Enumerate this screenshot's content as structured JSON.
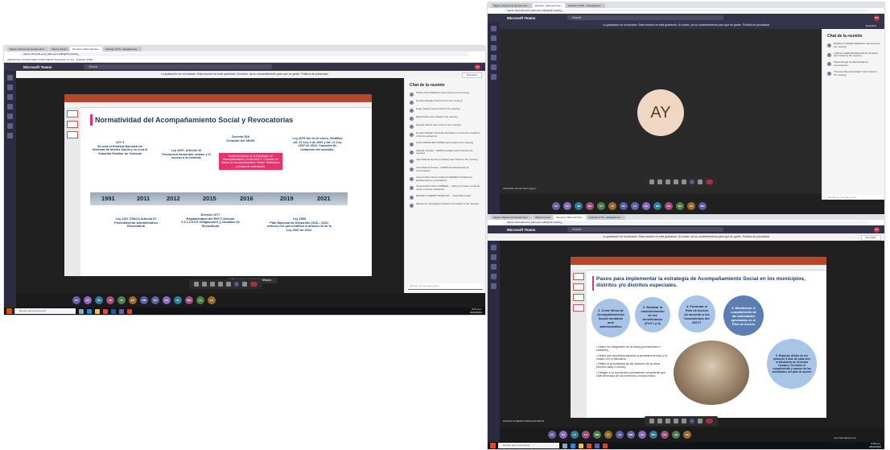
{
  "screenshot1": {
    "tabs": [
      "Sigob | Sistema de Gestión Doc...",
      "Yahoo! Correo",
      "Reunión | Microsoft Tea...",
      "Noticias (773) - delegaciones..."
    ],
    "url": "teams.microsoft.com/_#/pre-join-calling/19:meeting_",
    "bookmarks": "Aplicaciones   YouTube   Maps   Gmail   Traducir   Asociación en Col...   Noticias (1790) ...",
    "app_title": "Microsoft Teams",
    "search_placeholder": "Buscar",
    "recording_notice": "La grabación se ha iniciado. Esta reunión se está grabando. Al unirse, da su consentimiento para que se grabe. Política de privacidad",
    "dismiss_label": "Descartar",
    "slide": {
      "title": "Normatividad del Acompañamiento Social y Revocatorias",
      "years": [
        "1991",
        "2011",
        "2012",
        "2015",
        "2016",
        "2019",
        "2021"
      ],
      "notes_top": [
        "LEY 3\nSe crea el Sistema Nacional de Vivienda de Interés Social y se crea el Subsidio Familiar de Vivienda",
        "Ley 1537, Artículo 16\nPromoción desarrollo urbano y el acceso a la vivienda",
        "Decreto 528\nCreación del SNVIS",
        "Ley 2079 del 14 de enero. Modifica art. 21 Ley 3 de 1991 y art. 21 Ley 1537 de 2012. Causales de revitación del subsidio."
      ],
      "pink_box": "Implementación de la Estrategia de Acompañamiento Social MVCT. Creación de Mesas de Acompañamiento Social. Relaciones y ciudad de articulación.",
      "notes_bottom": [
        "Ley 1437 CPACA Artículo 97\nProcedimiento Administrativo Revocatoria",
        "Decreto 1077\nReglamentario del MVCT Artículo 2.1.1.2.6.3.5 Obligaciones y Causales de Revocatoria",
        "Ley 1955\nPlan Nacional de Desarrollo 2018 – 2022, artículo 212 que modifica el artículo 16 de la Ley 1537 de 2012."
      ]
    },
    "mic_toast": "El micrófono está deshabilitado.",
    "chat": {
      "title": "Chat de la reunión",
      "messages": [
        "Nelson Ortiz Ballestero was invited to the meeting",
        "Hernan Delgado was invited to the meeting",
        "Diego Salazar was invited to the meeting",
        "Maria Ibarra was invited to the meeting",
        "Dayana Garcia was invited to the meeting",
        "Hernan Delgado (Invitado) Disculpa no encuentro el adjunto ni link de asistencia",
        "LUIS GONZALEZ GOMEZ was invited to the meeting",
        "Claudia Caicedo - CENM (Invitado) was invited to the meeting",
        "Juan Manuel Gomez (Invitado) was invited to the meeting",
        "Juan Manuel Gomez - PARRA ha abandonado la conversación",
        "Jorge Andres Duran Gutierrez PAEZES (Invitado) ha abandonado la conversación",
        "Jorge Andres Duran GABRIEL ... Dermy por favor enviar de nuevo el link de asistencia",
        "DANARY ALBERTO BARAJAS ... https://forms.gle/...",
        "Manuel de J Rodriguez Argüello ha invitado to the meeting"
      ],
      "compose_placeholder": "Escribir un mensaje nuevo"
    },
    "presenter_name": "DANARY ALBERTO BARAJAS ...",
    "participants": [
      "AV",
      "AV",
      "PE",
      "JV",
      "JV",
      "GC",
      "DM",
      "DV",
      "EV",
      "EI",
      "MO",
      "LA",
      "LF"
    ],
    "taskbar_search": "Escribe aquí para buscar",
    "clock": "8:12 a.m.\n23/04/2021"
  },
  "screenshot2": {
    "tabs": [
      "Sigob | Sistema de Gestión Doc...",
      "Reunión | Microsoft Tea...",
      "Noticias (1790) - Investigación..."
    ],
    "url": "teams.microsoft.com/_#/pre-join-calling/19:meeting_",
    "app_title": "Microsoft Teams",
    "search_placeholder": "Buscar",
    "recording_notice": "La grabación se ha iniciado. Esta reunión se está grabando. Al unirse, da su consentimiento para que se grabe. Política de privacidad",
    "dismiss_label": "Descartar",
    "big_avatar": "AY",
    "presenter_name": "Alexander Gómez Ruiz (Ague) ...",
    "chat": {
      "title": "Chat de la reunión",
      "messages": [
        "DANIELA GOMEZ MORENO was invited to the meeting",
        "CAROLA HERNANDEZ RIANO (Invitado) was invited to the meeting",
        "Paola Rangel ha abandonado la conversación",
        "*Varessa Rivera(Invitado)* was invited to the meeting"
      ],
      "compose_placeholder": "Escribir un mensaje nuevo"
    },
    "participants": [
      "AV",
      "AY",
      "JE",
      "DA",
      "AY",
      "JC",
      "DC",
      "LF",
      "EV",
      "ER",
      "VH",
      "DV",
      "CS",
      "MO"
    ]
  },
  "screenshot3": {
    "tabs": [
      "Sigob | Sistema de Gestión Doc...",
      "Yahoo! Correo",
      "Reunión | Microsoft Tea...",
      "Noticias (773) - delegaciones..."
    ],
    "url": "teams.microsoft.com/_#/pre-join-calling/19:meeting_",
    "app_title": "Microsoft Teams",
    "search_placeholder": "Buscar",
    "recording_notice": "La grabación se ha iniciado. Esta reunión se está grabando. Al unirse, da su consentimiento para que se grabe. Política de privacidad",
    "dismiss_label": "Descartar",
    "slide": {
      "title": "Pasos para implementar la estrategia de Acompañamiento Social en los municipios, distritos y/o distritos especiales.",
      "steps": [
        "1. Crear Mesa de Acompañamiento Social mediante acto administrativo",
        "2. Realizar la caracterización de los beneficiarios (FVG I y II)",
        "3. Formular el Plan de Acción de acuerdo a los lineamientos del MVCT",
        "4. Monitorear el cumplimiento de las actividades aprobadas en el Plan de Acción",
        "5. Reportar dentro de los primeros 5 días de cada mes al Ministerio de Vivienda Ciudad y Territorio el cumplimiento y avance de las actividades del plan de acción"
      ],
      "bullets": [
        "Definir los integrantes de la mesa (permanentes e invitados).",
        "Definir que secretaría asumirá la secretaría técnica y el enlace con el Ministerio.",
        "Definir la periodicidad de las sesiones de la mesa (mínimo cada 2 meses).",
        "Delegar a un funcionario permanente competente que este informado de los procesos y compromisos."
      ]
    },
    "presenter_name": "DANARY ALBERTO BARAJAS MEYR",
    "participants": [
      "AV",
      "AV",
      "JV",
      "LA",
      "MM",
      "AY",
      "JE",
      "MM",
      "ID",
      "MO",
      "CS",
      "JN",
      "AU"
    ],
    "self_name": "Juan Pablo Barrios Cruz",
    "taskbar_search": "Escribe aquí para buscar",
    "clock": "8:48 a.m.\n23/04/2021"
  },
  "colors": {
    "teams_bar": "#33344a",
    "teams_accent": "#6264a7",
    "ppt_ribbon": "#b7472a",
    "slide_title": "#1f3a6e",
    "pink_box": "#e8326e",
    "hangup": "#c4314b"
  }
}
